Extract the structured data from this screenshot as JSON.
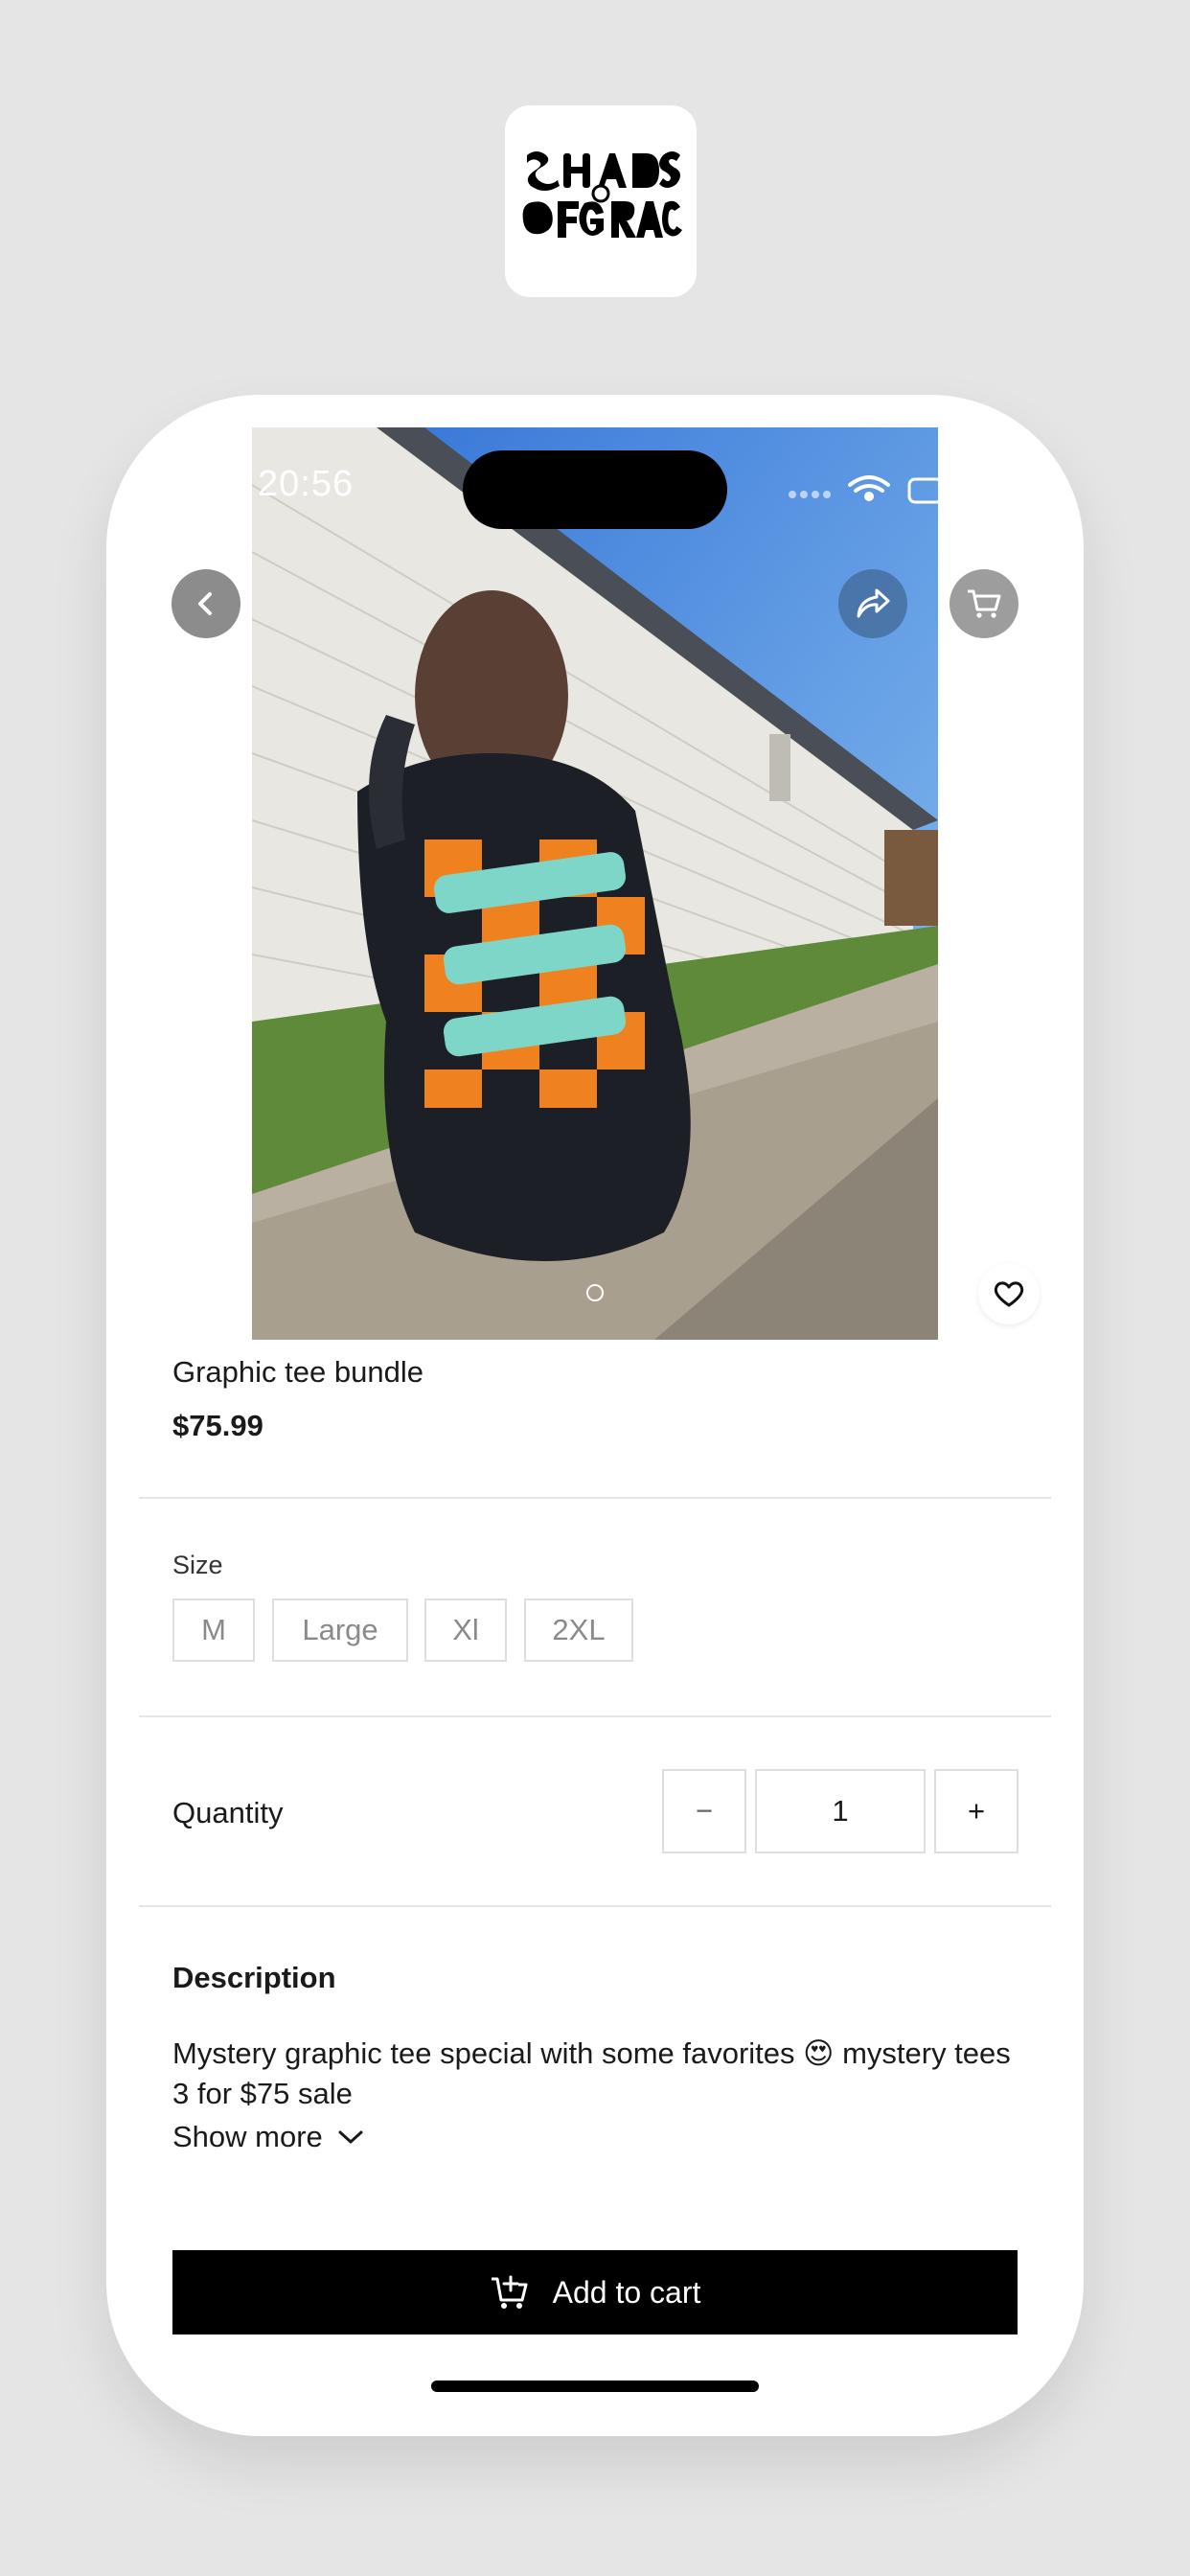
{
  "brand": {
    "logo_text": "SHADS OF GRACE"
  },
  "status_bar": {
    "time": "20:56"
  },
  "product": {
    "title": "Graphic tee bundle",
    "price": "$75.99",
    "image_index": 1,
    "image_count": 1
  },
  "size": {
    "label": "Size",
    "options": [
      "M",
      "Large",
      "Xl",
      "2XL"
    ]
  },
  "quantity": {
    "label": "Quantity",
    "decrement": "−",
    "value": "1",
    "increment": "+"
  },
  "description": {
    "heading": "Description",
    "text": "Mystery graphic tee special with some favorites 😍 mystery tees 3 for $75 sale",
    "show_more": "Show more"
  },
  "cta": {
    "add_to_cart": "Add to cart"
  },
  "colors": {
    "background": "#e5e5e5",
    "primary_button": "#000000",
    "border": "#dedede",
    "muted_text": "#8a8a8a"
  },
  "icons": [
    "back-icon",
    "share-icon",
    "cart-icon",
    "heart-icon",
    "chevron-down-icon",
    "add-to-cart-icon",
    "wifi-icon",
    "battery-icon"
  ]
}
